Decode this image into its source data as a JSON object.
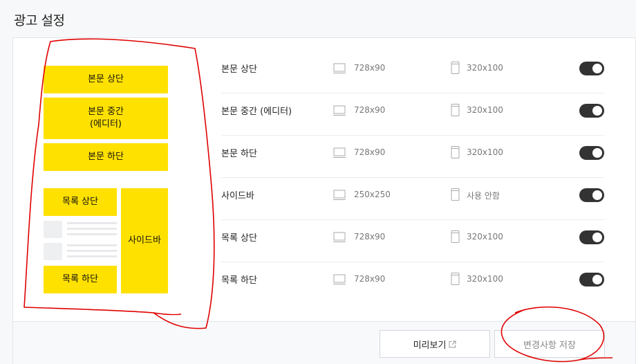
{
  "page": {
    "title": "광고 설정"
  },
  "preview": {
    "body_top": "본문 상단",
    "body_middle_line1": "본문 중간",
    "body_middle_line2": "(에디터)",
    "body_bottom": "본문 하단",
    "list_top": "목록 상단",
    "list_bottom": "목록 하단",
    "sidebar": "사이드바"
  },
  "slots": [
    {
      "name": "본문 상단",
      "pc_size": "728x90",
      "mobile_size": "320x100",
      "enabled": true
    },
    {
      "name": "본문 중간 (에디터)",
      "pc_size": "728x90",
      "mobile_size": "320x100",
      "enabled": true
    },
    {
      "name": "본문 하단",
      "pc_size": "728x90",
      "mobile_size": "320x100",
      "enabled": true
    },
    {
      "name": "사이드바",
      "pc_size": "250x250",
      "mobile_size": "사용 안함",
      "enabled": true
    },
    {
      "name": "목록 상단",
      "pc_size": "728x90",
      "mobile_size": "320x100",
      "enabled": true
    },
    {
      "name": "목록 하단",
      "pc_size": "728x90",
      "mobile_size": "320x100",
      "enabled": true
    }
  ],
  "footer": {
    "preview_label": "미리보기",
    "save_label": "변경사항 저장"
  },
  "colors": {
    "ad_yellow": "#ffe100",
    "toggle_on": "#333333",
    "scribble": "#e00000"
  }
}
